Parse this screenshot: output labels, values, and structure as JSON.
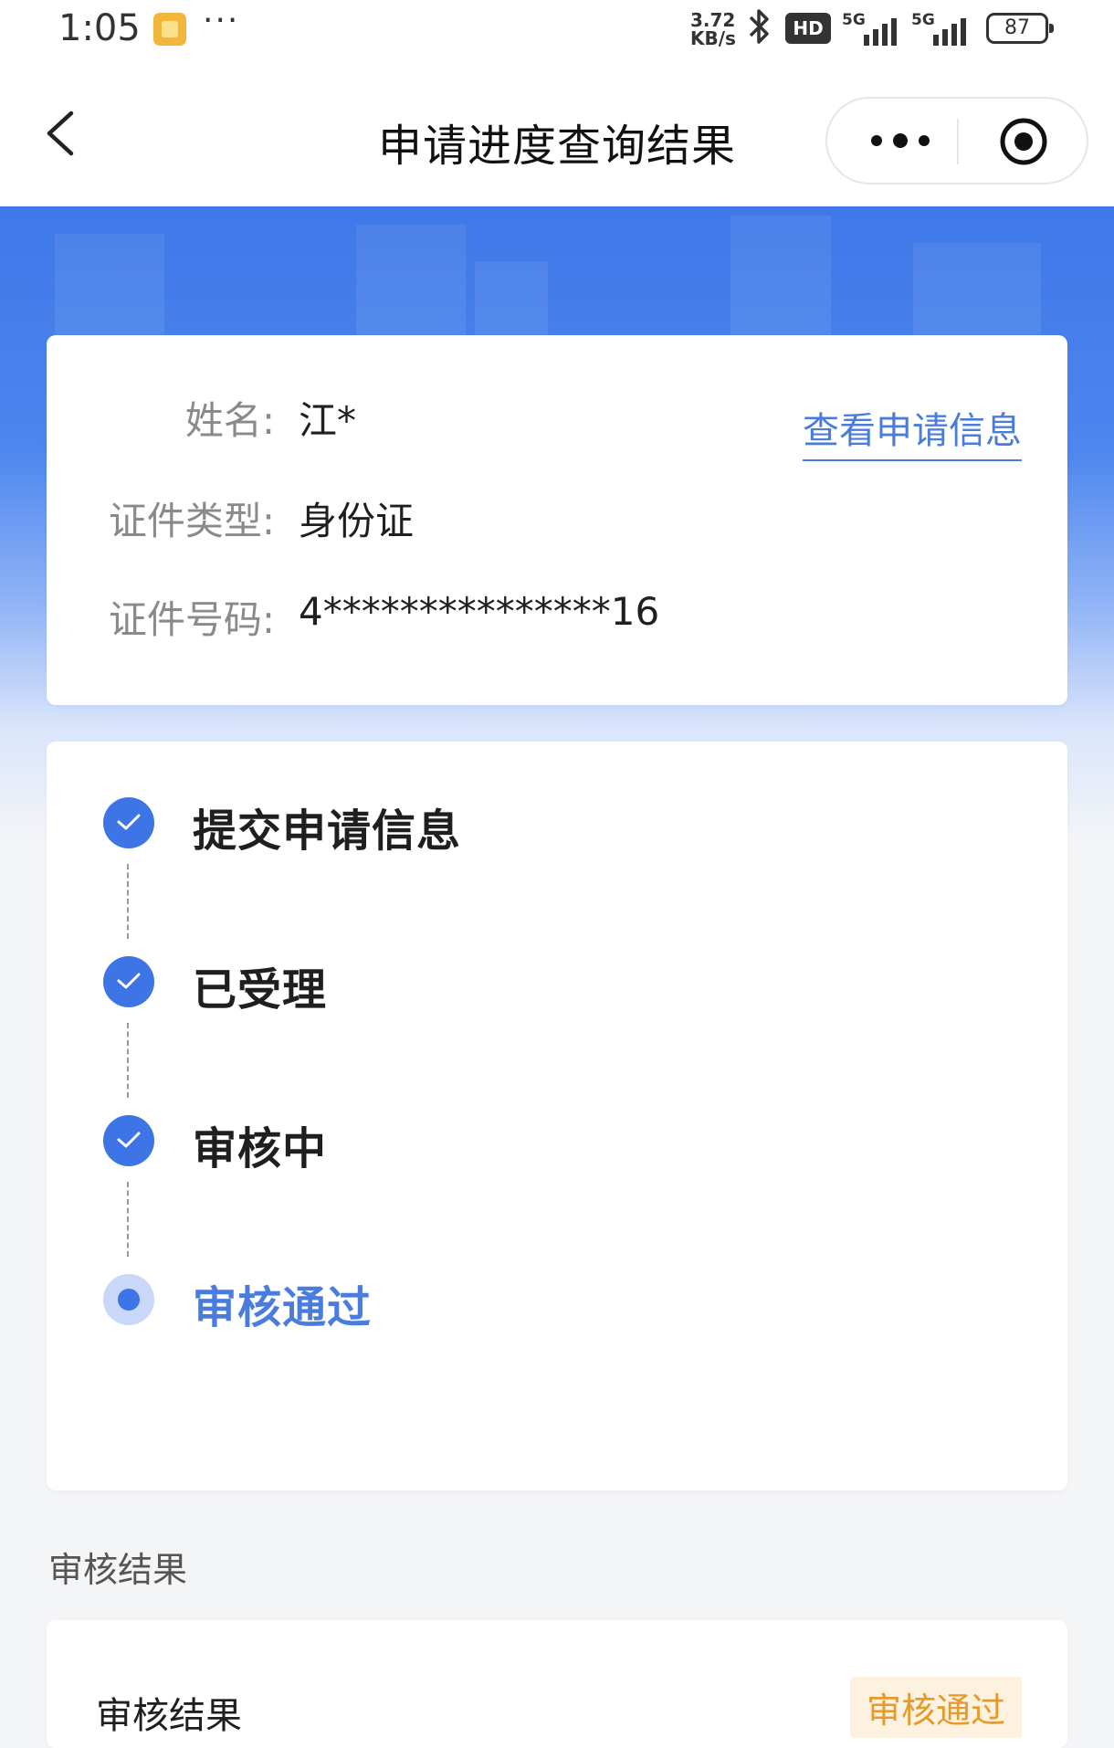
{
  "status_bar": {
    "time": "1:05",
    "speed": "3.72\nKB/s",
    "speed_line1": "3.72",
    "speed_line2": "KB/s",
    "bluetooth_icon": "bluetooth-icon",
    "hd_label": "HD",
    "signal1_label": "5G",
    "signal2_label": "5G",
    "battery": "87"
  },
  "nav": {
    "title": "申请进度查询结果"
  },
  "applicant": {
    "name_label": "姓名:",
    "name_value": "江*",
    "id_type_label": "证件类型:",
    "id_type_value": "身份证",
    "id_number_label": "证件号码:",
    "id_number_value": "4***************16",
    "view_link": "查看申请信息"
  },
  "steps": [
    {
      "label": "提交申请信息",
      "status": "done"
    },
    {
      "label": "已受理",
      "status": "done"
    },
    {
      "label": "审核中",
      "status": "done"
    },
    {
      "label": "审核通过",
      "status": "current"
    }
  ],
  "result_section": {
    "title": "审核结果",
    "row_label": "审核结果",
    "badge": "审核通过"
  },
  "colors": {
    "accent": "#3d74e6",
    "link": "#4a7cdd",
    "badge_text": "#e59a2b",
    "badge_bg": "#fdf2df"
  }
}
